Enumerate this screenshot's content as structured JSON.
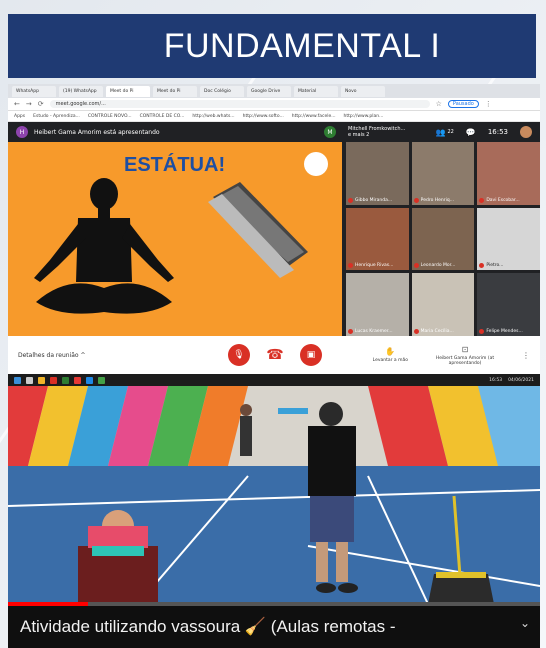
{
  "banner": {
    "title": "FUNDAMENTAL I"
  },
  "browser": {
    "tabs": [
      "WhatsApp",
      "(19) WhatsApp",
      "Meet do Pi",
      "Meet do Pi",
      "Doc Colégio",
      "Google Drive",
      "Material",
      "Novo"
    ],
    "url": "meet.google.com/...",
    "profile_label": "Pausado",
    "bookmarks": [
      "Apps",
      "Estudo - Aprendiza...",
      "CONTROLE NOVO...",
      "CONTROLE DE CO...",
      "http://web.whats...",
      "http://www.softo...",
      "http://www.facele...",
      "http://www.plan..."
    ]
  },
  "meet": {
    "presenter_initial": "H",
    "presenting_text": "Heibert Gama Amorim está apresentando",
    "pinned_initial": "M",
    "pinned_name": "Mitchell Fromkowitch...",
    "pinned_sub": "e mais 2",
    "people_count": "22",
    "time": "16:53",
    "slide_title": "ESTÁTUA!",
    "participants": [
      {
        "name": "Gibbo Miranda..."
      },
      {
        "name": "Pedro Henriq..."
      },
      {
        "name": "Davi Escobar..."
      },
      {
        "name": "Henrique Rivas..."
      },
      {
        "name": "Leonardo Mor..."
      },
      {
        "name": "Pietro..."
      },
      {
        "name": "Lucas Kraemer..."
      },
      {
        "name": "Maria Cecília..."
      },
      {
        "name": "Felipe Mendes..."
      }
    ],
    "details_label": "Detalhes da reunião",
    "raise_hand_label": "Levantar a mão",
    "present_label": "Heibert Gama Amorim (at apresentando)"
  },
  "video": {
    "tray_time": "16:53",
    "tray_date": "04/06/2021",
    "progress": 0.15,
    "title": "Atividade utilizando vassoura 🧹 (Aulas remotas -"
  }
}
